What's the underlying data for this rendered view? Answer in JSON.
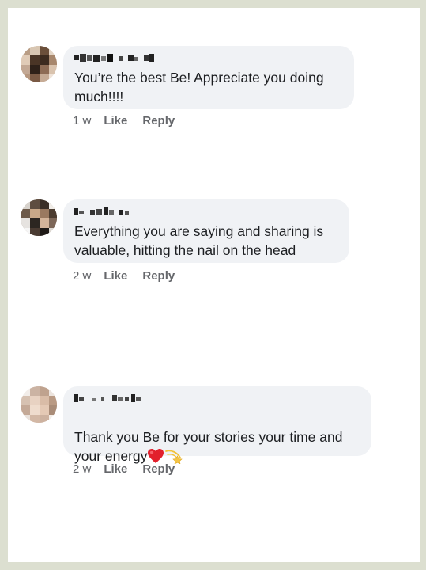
{
  "comments": [
    {
      "author": "",
      "text": "You’re the best Be! Appreciate you doing\nmuch!!!!",
      "time": "1 w",
      "like_label": "Like",
      "reply_label": "Reply"
    },
    {
      "author": "",
      "text": "Everything you are saying and sharing is\nvaluable, hitting the nail on the head",
      "time": "2 w",
      "like_label": "Like",
      "reply_label": "Reply"
    },
    {
      "author": "",
      "text": "Thank you Be for your stories your time and\nyour energy",
      "time": "2 w",
      "like_label": "Like",
      "reply_label": "Reply"
    }
  ],
  "colors": {
    "frame": "#dcdfd0",
    "card": "#ffffff",
    "bubble": "#f0f2f5",
    "text": "#1c1e21",
    "meta": "#65676b"
  },
  "icons": {
    "heart": "red-heart-icon",
    "dizzy": "dizzy-star-icon"
  }
}
